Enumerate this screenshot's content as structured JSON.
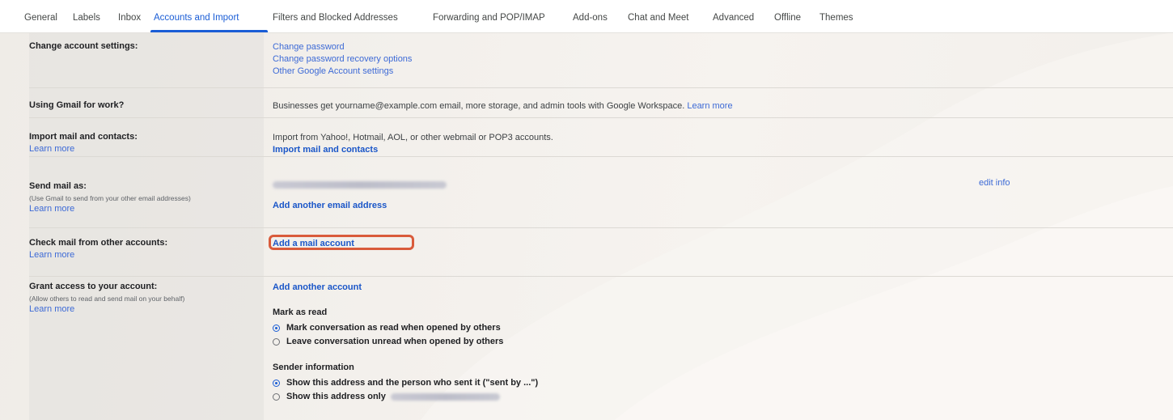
{
  "tabs": [
    {
      "label": "General"
    },
    {
      "label": "Labels"
    },
    {
      "label": "Inbox"
    },
    {
      "label": "Accounts and Import"
    },
    {
      "label": "Filters and Blocked Addresses"
    },
    {
      "label": "Forwarding and POP/IMAP"
    },
    {
      "label": "Add-ons"
    },
    {
      "label": "Chat and Meet"
    },
    {
      "label": "Advanced"
    },
    {
      "label": "Offline"
    },
    {
      "label": "Themes"
    }
  ],
  "active_tab": "Accounts and Import",
  "common": {
    "learn_more": "Learn more"
  },
  "sections": {
    "change_account": {
      "label": "Change account settings:",
      "links": [
        "Change password",
        "Change password recovery options",
        "Other Google Account settings"
      ]
    },
    "gmail_for_work": {
      "label": "Using Gmail for work?",
      "text": "Businesses get yourname@example.com email, more storage, and admin tools with Google Workspace.",
      "link": "Learn more"
    },
    "import_mail": {
      "label": "Import mail and contacts:",
      "text": "Import from Yahoo!, Hotmail, AOL, or other webmail or POP3 accounts.",
      "action": "Import mail and contacts"
    },
    "send_mail_as": {
      "label": "Send mail as:",
      "sublabel": "(Use Gmail to send from your other email addresses)",
      "edit": "edit info",
      "action": "Add another email address"
    },
    "check_mail": {
      "label": "Check mail from other accounts:",
      "action": "Add a mail account"
    },
    "grant_access": {
      "label": "Grant access to your account:",
      "sublabel": "(Allow others to read and send mail on your behalf)",
      "action": "Add another account",
      "mark_as_read": {
        "title": "Mark as read",
        "options": [
          {
            "label": "Mark conversation as read when opened by others",
            "checked": true
          },
          {
            "label": "Leave conversation unread when opened by others",
            "checked": false
          }
        ]
      },
      "sender_info": {
        "title": "Sender information",
        "options": [
          {
            "label": "Show this address and the person who sent it (\"sent by ...\")",
            "checked": true
          },
          {
            "label": "Show this address only",
            "checked": false
          }
        ]
      }
    }
  },
  "colors": {
    "accent": "#1a5dd6",
    "link": "#3d6ad6",
    "highlight": "#d95b3b"
  }
}
